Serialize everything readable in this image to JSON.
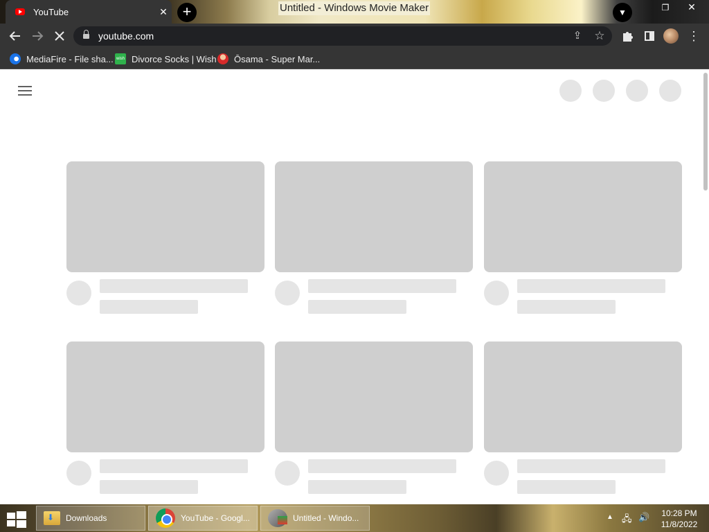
{
  "browser": {
    "tab": {
      "title": "YouTube",
      "close_icon": "close-icon",
      "favicon": "youtube-icon"
    },
    "new_tab_icon": "plus-icon",
    "background_window_title": "Untitled - Windows Movie Maker",
    "tab_search_icon": "chevron-down-icon",
    "omnibox": {
      "url": "youtube.com"
    },
    "bookmarks": [
      {
        "label": "MediaFire - File sha..."
      },
      {
        "label": "Divorce Socks | Wish"
      },
      {
        "label": "Ōsama - Super Mar..."
      }
    ]
  },
  "page": {
    "state": "loading",
    "skeleton_rows": 2,
    "skeleton_columns": 3
  },
  "taskbar": {
    "buttons": [
      {
        "label": "Downloads"
      },
      {
        "label": "YouTube - Googl..."
      },
      {
        "label": "Untitled - Windo..."
      }
    ],
    "clock": {
      "time": "10:28 PM",
      "date": "11/8/2022"
    }
  }
}
